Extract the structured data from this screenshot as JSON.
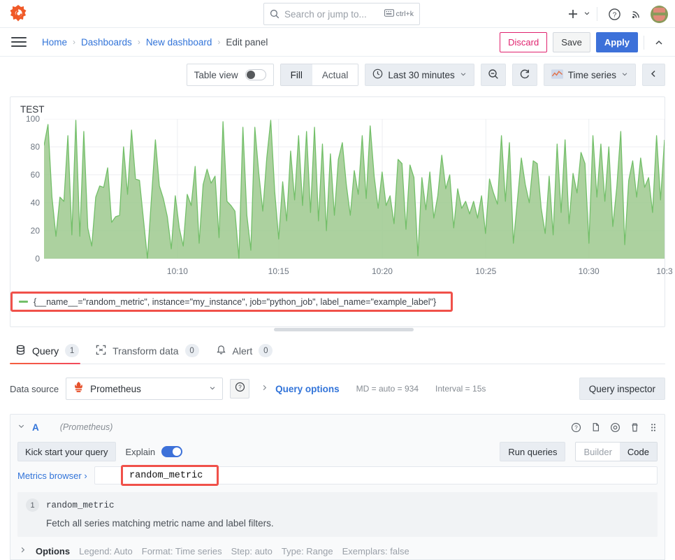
{
  "topnav": {
    "logo": "grafana-logo",
    "search": {
      "placeholder": "Search or jump to...",
      "shortcut": "ctrl+k"
    },
    "actions": {
      "add_label": "+",
      "help_label": "?",
      "news_label": "news-feed",
      "avatar_label": "user-avatar"
    }
  },
  "breadcrumb": {
    "items": [
      {
        "label": "Home",
        "current": false
      },
      {
        "label": "Dashboards",
        "current": false
      },
      {
        "label": "New dashboard",
        "current": false
      },
      {
        "label": "Edit panel",
        "current": true
      }
    ],
    "separator": "›",
    "actions": {
      "discard": "Discard",
      "save": "Save",
      "apply": "Apply",
      "collapse": "∧"
    }
  },
  "panel_toolbar": {
    "table_view_label": "Table view",
    "table_view_on": false,
    "fill_actual": {
      "options": [
        "Fill",
        "Actual"
      ],
      "selected": "Fill"
    },
    "time_range": "Last 30 minutes",
    "zoom_out_label": "zoom-out",
    "refresh_label": "refresh",
    "viz_type": "Time series",
    "collapse_options_label": "‹"
  },
  "panel": {
    "title": "TEST",
    "legend": {
      "text": "{__name__=\"random_metric\", instance=\"my_instance\", job=\"python_job\", label_name=\"example_label\"}",
      "color": "#73bf69",
      "highlighted": true
    }
  },
  "chart_data": {
    "type": "area",
    "title": "TEST",
    "xlabel": "",
    "ylabel": "",
    "ylim": [
      0,
      100
    ],
    "grid": true,
    "legend_position": "bottom",
    "series_name": "{__name__=\"random_metric\", instance=\"my_instance\", job=\"python_job\", label_name=\"example_label\"}",
    "line_color": "#73bf69",
    "fill_color": "#9dc98e",
    "ytick_labels": [
      "0",
      "20",
      "40",
      "60",
      "80",
      "100"
    ],
    "yticks": [
      0,
      20,
      40,
      60,
      80,
      100
    ],
    "xtick_labels": [
      "10:10",
      "10:15",
      "10:20",
      "10:25",
      "10:30",
      "10:3"
    ],
    "xticks_fraction": [
      0.215,
      0.378,
      0.545,
      0.712,
      0.878,
      1.0
    ],
    "x_start": "10:05",
    "x_end": "10:35",
    "values": [
      81,
      96,
      44,
      16,
      44,
      41,
      88,
      17,
      99,
      16,
      91,
      22,
      9,
      44,
      52,
      51,
      65,
      26,
      30,
      31,
      80,
      46,
      92,
      57,
      56,
      28,
      0,
      43,
      85,
      52,
      43,
      30,
      7,
      45,
      22,
      9,
      46,
      38,
      66,
      11,
      53,
      64,
      54,
      59,
      15,
      98,
      41,
      38,
      34,
      0,
      94,
      31,
      6,
      94,
      61,
      34,
      72,
      99,
      48,
      14,
      55,
      27,
      77,
      42,
      88,
      38,
      91,
      33,
      94,
      27,
      82,
      20,
      75,
      31,
      71,
      83,
      53,
      31,
      63,
      46,
      88,
      43,
      95,
      59,
      36,
      62,
      38,
      45,
      25,
      71,
      68,
      21,
      67,
      58,
      2,
      58,
      35,
      62,
      29,
      45,
      74,
      50,
      60,
      22,
      50,
      36,
      41,
      32,
      41,
      29,
      45,
      18,
      57,
      47,
      39,
      88,
      41,
      83,
      11,
      41,
      72,
      53,
      40,
      70,
      68,
      36,
      18,
      59,
      17,
      82,
      33,
      85,
      25,
      61,
      47,
      76,
      68,
      11,
      88,
      44,
      82,
      41,
      80,
      23,
      51,
      91,
      10,
      56,
      70,
      44,
      72,
      51,
      58,
      33,
      88,
      42,
      85
    ]
  },
  "tabs": [
    {
      "label": "Query",
      "badge": "1",
      "icon": "database-icon",
      "active": true
    },
    {
      "label": "Transform data",
      "badge": "0",
      "icon": "transform-icon",
      "active": false
    },
    {
      "label": "Alert",
      "badge": "0",
      "icon": "bell-icon",
      "active": false
    }
  ],
  "datasource_row": {
    "label": "Data source",
    "selected": "Prometheus",
    "help_icon": "help-icon",
    "query_options_label": "Query options",
    "meta_md": "MD = auto = 934",
    "meta_interval": "Interval = 15s",
    "query_inspector": "Query inspector"
  },
  "query_editor": {
    "ref_id": "A",
    "datasource_note": "(Prometheus)",
    "row_icons": [
      "help-icon",
      "duplicate-icon",
      "eye-icon",
      "trash-icon",
      "drag-handle-icon"
    ],
    "kick_start": "Kick start your query",
    "explain_label": "Explain",
    "explain_on": true,
    "run_queries": "Run queries",
    "mode": {
      "options": [
        "Builder",
        "Code"
      ],
      "selected": "Code"
    },
    "metrics_browser": "Metrics browser ›",
    "query_value": "random_metric",
    "query_highlighted": true,
    "explanation": {
      "number": "1",
      "code": "random_metric",
      "description": "Fetch all series matching metric name and label filters."
    }
  },
  "options_row": {
    "title": "Options",
    "items": [
      "Legend: Auto",
      "Format: Time series",
      "Step: auto",
      "Type: Range",
      "Exemplars: false"
    ]
  }
}
